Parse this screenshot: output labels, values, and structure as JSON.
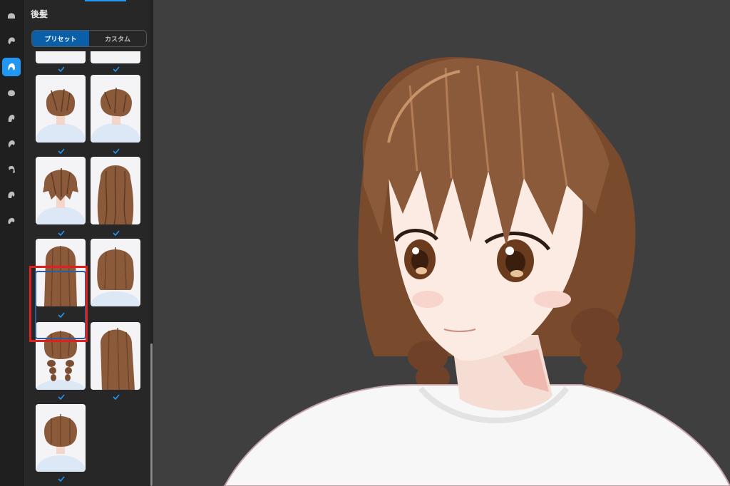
{
  "panel": {
    "title": "後髪",
    "tabs": [
      {
        "label": "プリセット",
        "active": true
      },
      {
        "label": "カスタム",
        "active": false
      }
    ]
  },
  "rail": {
    "icons": [
      "head-icon",
      "front-hair-icon",
      "back-hair-icon",
      "hair-icon-4",
      "hair-icon-5",
      "hair-icon-6",
      "hair-icon-7",
      "hair-icon-8",
      "hair-icon-9"
    ],
    "active_index": 2
  },
  "presets": {
    "items": [
      {
        "style": "short-back",
        "selected": false
      },
      {
        "style": "short-side",
        "selected": false
      },
      {
        "style": "messy-short",
        "selected": false
      },
      {
        "style": "long-wavy",
        "selected": false
      },
      {
        "style": "long-straight",
        "selected": false
      },
      {
        "style": "bob",
        "selected": false
      },
      {
        "style": "twin-braids",
        "selected": true
      },
      {
        "style": "long-side",
        "selected": false
      },
      {
        "style": "short-bob",
        "selected": false
      }
    ]
  },
  "colors": {
    "accent": "#2196f3",
    "selection_highlight": "#e01f1f",
    "hair_brown": "#8b5a3a",
    "viewport_bg": "#3f3f3f"
  }
}
